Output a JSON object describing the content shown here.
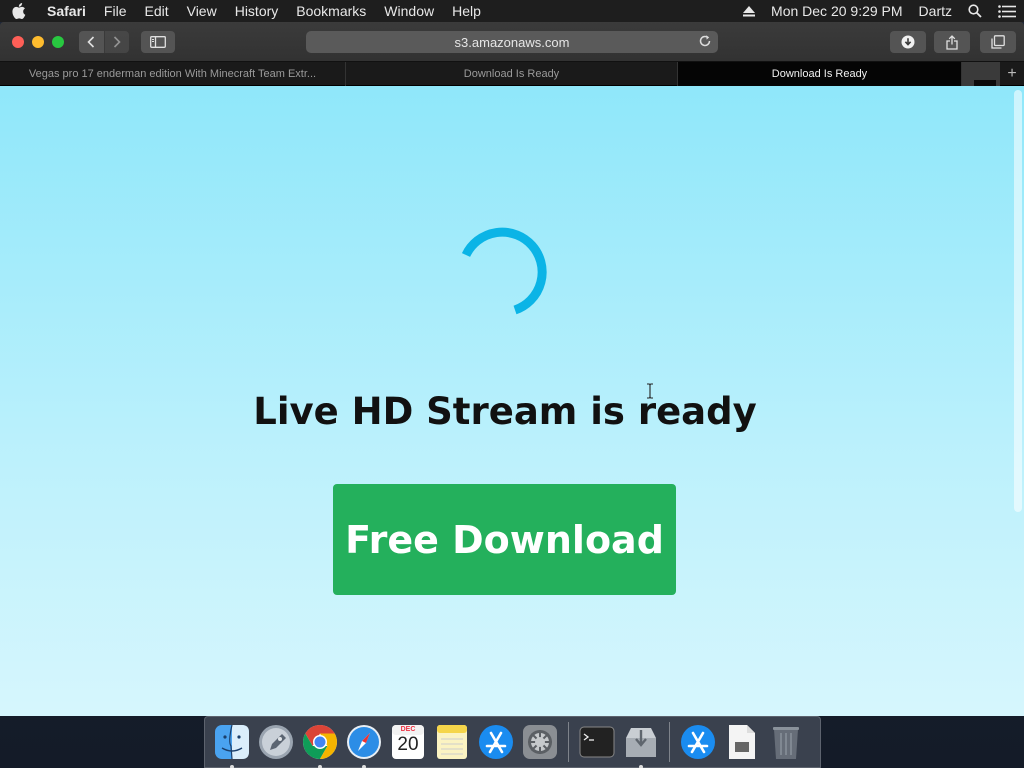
{
  "menubar": {
    "app_name": "Safari",
    "menus": [
      "File",
      "Edit",
      "View",
      "History",
      "Bookmarks",
      "Window",
      "Help"
    ],
    "datetime": "Mon Dec 20  9:29 PM",
    "user": "Dartz",
    "icons": [
      "apple-icon",
      "eject-icon",
      "spotlight-search-icon",
      "notification-center-icon"
    ]
  },
  "toolbar": {
    "address": "s3.amazonaws.com",
    "icons": [
      "back-icon",
      "forward-icon",
      "sidebar-icon",
      "reload-icon",
      "downloads-icon",
      "share-icon",
      "tabs-overview-icon"
    ]
  },
  "tabs": [
    {
      "title": "Vegas pro 17 enderman edition With Minecraft Team Extr...",
      "active": false
    },
    {
      "title": "Download Is Ready",
      "active": false
    },
    {
      "title": "Download Is Ready",
      "active": true
    }
  ],
  "page": {
    "headline": "Live HD Stream is ready",
    "cta_label": "Free Download",
    "colors": {
      "background_top": "#8fe7fa",
      "spinner": "#0bb4e6",
      "cta": "#24b05c"
    }
  },
  "dock": {
    "calendar_month": "DEC",
    "calendar_day": "20",
    "icons": [
      "finder-icon",
      "launchpad-icon",
      "chrome-icon",
      "safari-icon",
      "calendar-icon",
      "notes-icon",
      "app-store-icon",
      "system-preferences-icon",
      "terminal-icon",
      "downloads-folder-icon",
      "app-store-folder-icon",
      "document-icon",
      "trash-icon"
    ]
  }
}
